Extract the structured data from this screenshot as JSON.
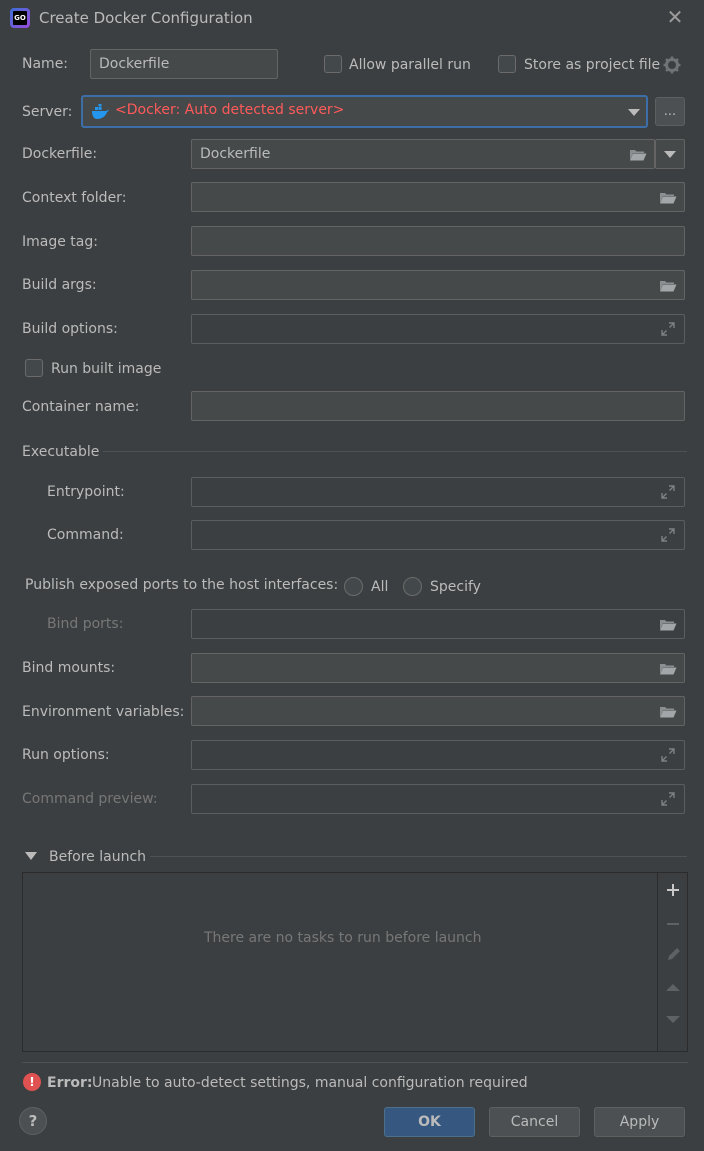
{
  "window": {
    "title": "Create Docker Configuration",
    "app_icon_text": "GO"
  },
  "header": {
    "name_label": "Name:",
    "name_value": "Dockerfile",
    "allow_parallel_label": "Allow parallel run",
    "store_project_label": "Store as project file"
  },
  "server": {
    "label": "Server:",
    "value": "<Docker: Auto detected server>",
    "dots_label": "..."
  },
  "form": {
    "dockerfile_label": "Dockerfile:",
    "dockerfile_value": "Dockerfile",
    "context_folder_label": "Context folder:",
    "image_tag_label": "Image tag:",
    "build_args_label": "Build args:",
    "build_options_label": "Build options:",
    "run_built_image_label": "Run built image",
    "container_name_label": "Container name:",
    "executable_label": "Executable",
    "entrypoint_label": "Entrypoint:",
    "command_label": "Command:",
    "publish_ports_label": "Publish exposed ports to the host interfaces:",
    "radio_all_label": "All",
    "radio_specify_label": "Specify",
    "bind_ports_label": "Bind ports:",
    "bind_mounts_label": "Bind mounts:",
    "env_vars_label": "Environment variables:",
    "run_options_label": "Run options:",
    "command_preview_label": "Command preview:"
  },
  "before_launch": {
    "label": "Before launch",
    "empty_message": "There are no tasks to run before launch"
  },
  "status": {
    "error_prefix": "Error:",
    "error_message": "Unable to auto-detect settings, manual configuration required"
  },
  "buttons": {
    "help": "?",
    "ok": "OK",
    "cancel": "Cancel",
    "apply": "Apply"
  },
  "colors": {
    "background": "#3c3f41",
    "field": "#45494a",
    "accent_border": "#3d6ea8",
    "error_text": "#ff5a5a",
    "primary_button": "#365880"
  }
}
